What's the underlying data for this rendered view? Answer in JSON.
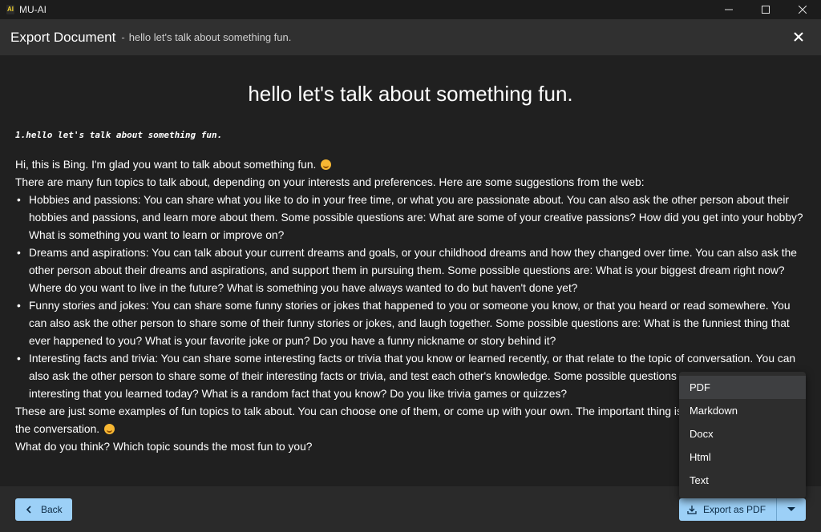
{
  "window": {
    "app_logo_text": "AI",
    "app_title": "MU-AI"
  },
  "header": {
    "title": "Export Document",
    "separator": "-",
    "subtitle": "hello let's talk about something fun."
  },
  "document": {
    "title": "hello let's talk about something fun.",
    "heading": "1.hello let's talk about something fun.",
    "intro": "Hi, this is Bing. I'm glad you want to talk about something fun.",
    "lead": "There are many fun topics to talk about, depending on your interests and preferences. Here are some suggestions from the web:",
    "items": [
      "Hobbies and passions: You can share what you like to do in your free time, or what you are passionate about. You can also ask the other person about their hobbies and passions, and learn more about them. Some possible questions are: What are some of your creative passions? How did you get into your hobby? What is something you want to learn or improve on?",
      "Dreams and aspirations: You can talk about your current dreams and goals, or your childhood dreams and how they changed over time. You can also ask the other person about their dreams and aspirations, and support them in pursuing them. Some possible questions are: What is your biggest dream right now? Where do you want to live in the future? What is something you have always wanted to do but haven't done yet?",
      "Funny stories and jokes: You can share some funny stories or jokes that happened to you or someone you know, or that you heard or read somewhere. You can also ask the other person to share some of their funny stories or jokes, and laugh together. Some possible questions are: What is the funniest thing that ever happened to you? What is your favorite joke or pun? Do you have a funny nickname or story behind it?",
      "Interesting facts and trivia: You can share some interesting facts or trivia that you know or learned recently, or that relate to the topic of conversation. You can also ask the other person to share some of their interesting facts or trivia, and test each other's knowledge. Some possible questions are: What is something interesting that you learned today? What is a random fact that you know? Do you like trivia games or quizzes?"
    ],
    "closing": "These are just some examples of fun topics to talk about. You can choose one of them, or come up with your own. The important thing is to have fun and enjoy the conversation.",
    "question": "What do you think? Which topic sounds the most fun to you?"
  },
  "footer": {
    "back_label": "Back",
    "export_label": "Export as PDF"
  },
  "export_menu": {
    "selected": "PDF",
    "options": [
      "PDF",
      "Markdown",
      "Docx",
      "Html",
      "Text"
    ]
  },
  "colors": {
    "accent": "#9cd0f7",
    "background": "#202020",
    "header": "#303030",
    "menu": "#2d2d2d"
  }
}
